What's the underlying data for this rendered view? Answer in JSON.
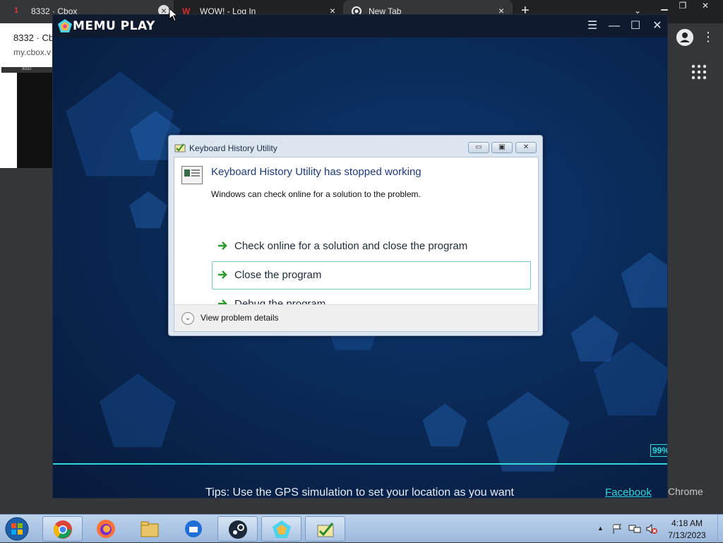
{
  "chrome": {
    "tabs": [
      {
        "label": "8332 · Cbox",
        "badge": "1"
      },
      {
        "label": "WOW! - Log In"
      },
      {
        "label": "New Tab"
      }
    ],
    "popup_title": "8332 · Cb",
    "popup_url": "my.cbox.v",
    "thumb_header": "8332",
    "bottom_label": "Chrome"
  },
  "memu": {
    "title": "MEMU PLAY",
    "progress": "99%",
    "progress_value": 0.99,
    "tips": "Tips: Use the GPS simulation to set your location as you want",
    "facebook_link": "Facebook"
  },
  "dialog": {
    "title": "Keyboard History Utility",
    "heading": "Keyboard History Utility has stopped working",
    "subtext": "Windows can check online for a solution to the problem.",
    "options": [
      {
        "label": "Check online for a solution and close the program"
      },
      {
        "label": "Close the program"
      },
      {
        "label": "Debug the program"
      }
    ],
    "details_label": "View problem details"
  },
  "taskbar": {
    "clock_time": "4:18 AM",
    "clock_date": "7/13/2023"
  },
  "colors": {
    "accent": "#31d6d6",
    "memu_bg": "#0b2347",
    "dialog_heading": "#1d3a79"
  }
}
